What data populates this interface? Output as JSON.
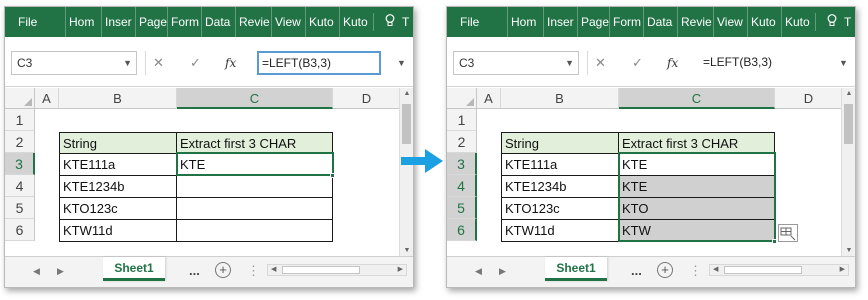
{
  "ribbon_tabs": [
    "File",
    "Hom",
    "Inser",
    "Page",
    "Form",
    "Data",
    "Revie",
    "View",
    "Kuto",
    "Kuto"
  ],
  "left": {
    "name_box": "C3",
    "formula": "=LEFT(B3,3)",
    "columns": [
      "A",
      "B",
      "C",
      "D"
    ],
    "rows": [
      "1",
      "2",
      "3",
      "4",
      "5",
      "6"
    ],
    "table": {
      "header": [
        "String",
        "Extract first 3 CHAR"
      ],
      "rows": [
        [
          "KTE111a",
          "KTE"
        ],
        [
          "KTE1234b",
          ""
        ],
        [
          "KTO123c",
          ""
        ],
        [
          "KTW11d",
          ""
        ]
      ]
    },
    "sheet_tab": "Sheet1",
    "more_sheets": "..."
  },
  "right": {
    "name_box": "C3",
    "formula": "=LEFT(B3,3)",
    "columns": [
      "A",
      "B",
      "C",
      "D"
    ],
    "rows": [
      "1",
      "2",
      "3",
      "4",
      "5",
      "6"
    ],
    "table": {
      "header": [
        "String",
        "Extract first 3 CHAR"
      ],
      "rows": [
        [
          "KTE111a",
          "KTE"
        ],
        [
          "KTE1234b",
          "KTE"
        ],
        [
          "KTO123c",
          "KTO"
        ],
        [
          "KTW11d",
          "KTW"
        ]
      ]
    },
    "sheet_tab": "Sheet1",
    "more_sheets": "..."
  },
  "icons": {
    "cancel": "✕",
    "enter": "✓",
    "fx": "fx",
    "dropdown": "▼",
    "scroll_left": "◀",
    "scroll_right": "▶",
    "add_sheet": "+",
    "arrow_color": "#1ba1e2"
  },
  "colors": {
    "ribbon": "#217346",
    "header_fill": "#e2efda",
    "filled_cells": "#d0d0d0"
  }
}
